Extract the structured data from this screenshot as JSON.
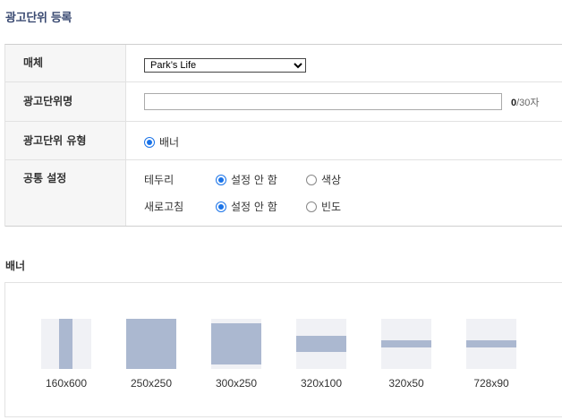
{
  "page_title": "광고단위 등록",
  "form": {
    "media": {
      "label": "매체",
      "selected": "Park’s Life"
    },
    "unit_name": {
      "label": "광고단위명",
      "value": "",
      "count": "0",
      "max": "/30자"
    },
    "unit_type": {
      "label": "광고단위 유형",
      "option": "배너"
    },
    "common": {
      "label": "공통 설정",
      "border": {
        "label": "테두리",
        "option_off": "설정 안 함",
        "option_color": "색상"
      },
      "refresh": {
        "label": "새로고침",
        "option_off": "설정 안 함",
        "option_freq": "빈도"
      }
    }
  },
  "banner_section": {
    "title": "배너",
    "items": [
      {
        "label": "160x600"
      },
      {
        "label": "250x250"
      },
      {
        "label": "300x250"
      },
      {
        "label": "320x100"
      },
      {
        "label": "320x50"
      },
      {
        "label": "728x90"
      }
    ]
  },
  "colors": {
    "accent": "#1a73e8",
    "title": "#3a4a72",
    "ad_fill": "#abb8d0",
    "thumb_bg": "#f0f1f5"
  }
}
